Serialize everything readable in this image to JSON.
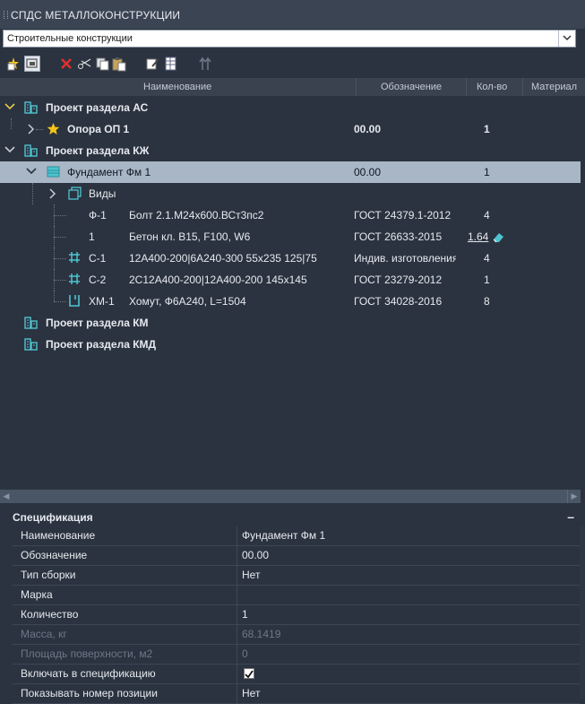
{
  "panel": {
    "title": "СПДС МЕТАЛЛОКОНСТРУКЦИИ"
  },
  "combo": {
    "value": "Строительные конструкции"
  },
  "toolbar": {
    "buttons": [
      "new-star-icon",
      "view-toggle-icon",
      "delete-icon",
      "cut-icon",
      "copy-icon",
      "paste-icon",
      "edit-icon",
      "table-icon",
      "move-up-icon"
    ]
  },
  "columns": {
    "name": "Наименование",
    "designation": "Обозначение",
    "qty": "Кол-во",
    "material": "Материал"
  },
  "tree": [
    {
      "label": "Проект раздела АС",
      "designation": "",
      "qty": ""
    },
    {
      "label": "Опора ОП 1",
      "designation": "00.00",
      "qty": "1"
    },
    {
      "label": "Проект раздела КЖ",
      "designation": "",
      "qty": ""
    },
    {
      "label": "Фундамент Фм 1",
      "designation": "00.00",
      "qty": "1"
    },
    {
      "label": "Виды",
      "designation": "",
      "qty": ""
    },
    {
      "pos": "Ф-1",
      "label": "Болт 2.1.М24х600.ВСт3пс2",
      "designation": "ГОСТ 24379.1-2012",
      "qty": "4"
    },
    {
      "pos": "1",
      "label": "Бетон кл. B15, F100, W6",
      "designation": "ГОСТ 26633-2015",
      "qty": "1.64"
    },
    {
      "pos": "С-1",
      "label": "12А400-200|6А240-300 55х235 125|75",
      "designation": "Индив. изготовления",
      "qty": "4"
    },
    {
      "pos": "С-2",
      "label": "2С12А400-200|12А400-200 145х145",
      "designation": "ГОСТ 23279-2012",
      "qty": "1"
    },
    {
      "pos": "ХМ-1",
      "label": "Хомут, Ф6А240, L=1504",
      "designation": "ГОСТ 34028-2016",
      "qty": "8"
    },
    {
      "label": "Проект раздела КМ",
      "designation": "",
      "qty": ""
    },
    {
      "label": "Проект раздела КМД",
      "designation": "",
      "qty": ""
    }
  ],
  "spec": {
    "title": "Спецификация",
    "collapse": "–",
    "rows": [
      {
        "key": "Наименование",
        "value": "Фундамент Фм 1"
      },
      {
        "key": "Обозначение",
        "value": "00.00"
      },
      {
        "key": "Тип сборки",
        "value": "Нет"
      },
      {
        "key": "Марка",
        "value": ""
      },
      {
        "key": "Количество",
        "value": "1"
      },
      {
        "key": "Масса, кг",
        "value": "68.1419"
      },
      {
        "key": "Площадь поверхности, м2",
        "value": "0"
      },
      {
        "key": "Включать в спецификацию",
        "value": "",
        "checked": true
      },
      {
        "key": "Показывать номер позиции",
        "value": "Нет"
      }
    ]
  },
  "colors": {
    "background": "#2b3340",
    "selected_row": "#a9b6c6",
    "accent_icon": "#4fc4cf",
    "star": "#f5c518"
  }
}
